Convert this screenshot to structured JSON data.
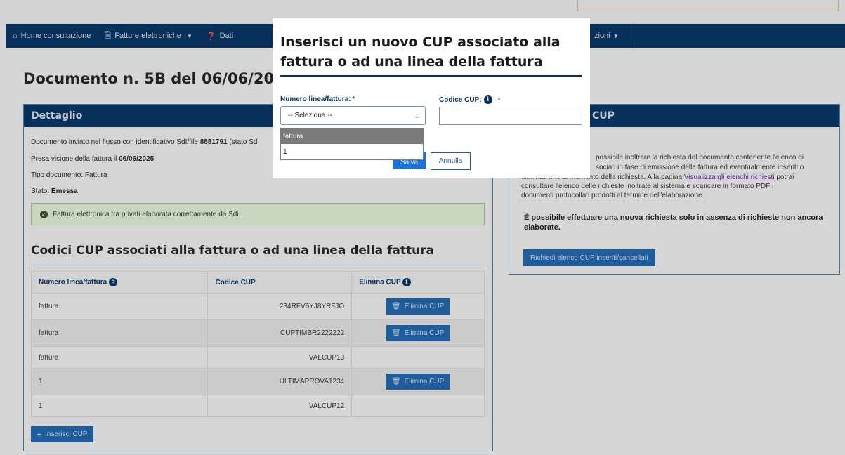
{
  "nav": {
    "items": [
      {
        "icon": "home-icon",
        "label": "Home consultazione",
        "caret": false
      },
      {
        "icon": "document-icon",
        "label": "Fatture elettroniche",
        "caret": true
      },
      {
        "icon": "info-circle-icon",
        "label": "Dati",
        "caret": false
      }
    ],
    "right_label": "zioni"
  },
  "document": {
    "title": "Documento n. 5B del 06/06/2025"
  },
  "detail": {
    "header": "Dettaglio",
    "line1_prefix": "Documento inviato nel flusso con identificativo SdI/file ",
    "line1_id": "8881791",
    "line1_suffix": " (stato Sd",
    "line2_prefix": "Presa visione della fattura il ",
    "line2_date": "06/06/2025",
    "line3": "Tipo documento: Fattura",
    "line4_prefix": "Stato: ",
    "line4_state": "Emessa",
    "alert": "Fattura elettronica tra privati elaborata correttamente da Sdi."
  },
  "cup_section": {
    "title": "Codici CUP associati alla fattura o ad una linea della fattura",
    "columns": [
      "Numero linea/fattura",
      "Codice CUP",
      "Elimina CUP"
    ],
    "rows": [
      {
        "line": "fattura",
        "code": "234RFV6YJ8YRFJO",
        "deletable": true
      },
      {
        "line": "fattura",
        "code": "CUPTIMBR2222222",
        "deletable": true
      },
      {
        "line": "fattura",
        "code": "VALCUP13",
        "deletable": false
      },
      {
        "line": "1",
        "code": "ULTIMAPROVA1234",
        "deletable": true
      },
      {
        "line": "1",
        "code": "VALCUP12",
        "deletable": false
      }
    ],
    "delete_label": "Elimina CUP",
    "insert_label": "Inserisci CUP"
  },
  "right_panel": {
    "header": "CUP",
    "text_l1": "possibile inoltrare la richiesta del documento contenente l'elenco di",
    "text_l2": "sociati in fase di emissione della fattura ed eventualmente inseriti o",
    "text_l3a": "eliminati fino al momento della richiesta. Alla pagina ",
    "text_l3_link": "Visualizza gli elenchi richiesti",
    "text_l3b": " potrai",
    "text_l4": "consultare l'elenco delle richieste inoltrate al sistema e scaricare in formato PDF i",
    "text_l5": "documenti protocollati prodotti al termine dell'elaborazione.",
    "bold_note": "È possibile effettuare una nuova richiesta solo in assenza di richieste non ancora elaborate.",
    "request_button": "Richiedi elenco CUP inseriti/cancellati"
  },
  "modal": {
    "title": "Inserisci un nuovo CUP associato alla fattura o ad una linea della fattura",
    "line_label": "Numero linea/fattura:",
    "line_required": "*",
    "cup_label": "Codice CUP:",
    "cup_required": "*",
    "select_value": "-- Seleziona --",
    "cup_value": "",
    "options": [
      "fattura",
      "1"
    ],
    "highlighted_option": "fattura",
    "save_label": "Salva",
    "cancel_label": "Annulla"
  },
  "colors": {
    "navy": "#07305b",
    "button_blue": "#1e5c9b",
    "primary_blue": "#1e72d6",
    "success_bg": "#c8d5bf",
    "overlay_bg": "#d5d5d5",
    "link_purple": "#5a2a86"
  }
}
